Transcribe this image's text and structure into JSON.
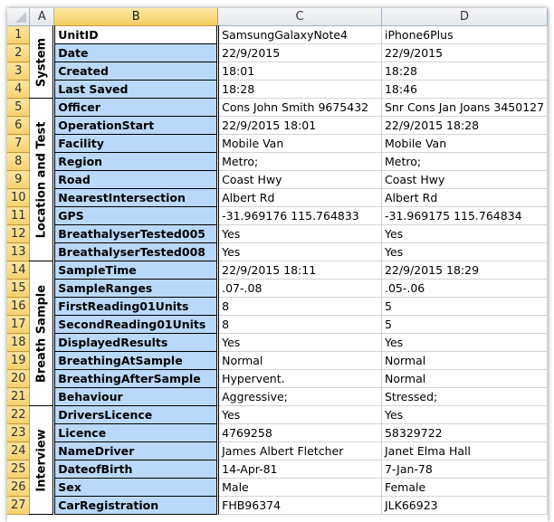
{
  "columns": [
    "A",
    "B",
    "C",
    "D"
  ],
  "groups": [
    {
      "label": "System",
      "start": 1,
      "span": 4
    },
    {
      "label": "Location and Test",
      "start": 5,
      "span": 9
    },
    {
      "label": "Breath Sample",
      "start": 14,
      "span": 8
    },
    {
      "label": "Interview",
      "start": 22,
      "span": 6
    }
  ],
  "rows": [
    {
      "n": "1",
      "field": "UnitID",
      "c": "SamsungGalaxyNote4",
      "d": "iPhone6Plus"
    },
    {
      "n": "2",
      "field": "Date",
      "c": "22/9/2015",
      "d": "22/9/2015"
    },
    {
      "n": "3",
      "field": "Created",
      "c": "18:01",
      "d": "18:28"
    },
    {
      "n": "4",
      "field": "Last Saved",
      "c": "18:28",
      "d": "18:46"
    },
    {
      "n": "5",
      "field": "Officer",
      "c": "Cons John Smith 9675432",
      "d": "Snr Cons Jan Joans 3450127"
    },
    {
      "n": "6",
      "field": "OperationStart",
      "c": "22/9/2015 18:01",
      "d": "22/9/2015 18:28"
    },
    {
      "n": "7",
      "field": "Facility",
      "c": "Mobile Van",
      "d": "Mobile Van"
    },
    {
      "n": "8",
      "field": "Region",
      "c": "Metro;",
      "d": "Metro;"
    },
    {
      "n": "9",
      "field": "Road",
      "c": "Coast Hwy",
      "d": "Coast Hwy"
    },
    {
      "n": "10",
      "field": "NearestIntersection",
      "c": "Albert Rd",
      "d": "Albert Rd"
    },
    {
      "n": "11",
      "field": "GPS",
      "c": "-31.969176  115.764833",
      "d": "-31.969175  115.764834"
    },
    {
      "n": "12",
      "field": "BreathalyserTested005",
      "c": "Yes",
      "d": "Yes"
    },
    {
      "n": "13",
      "field": "BreathalyserTested008",
      "c": "Yes",
      "d": "Yes"
    },
    {
      "n": "14",
      "field": "SampleTime",
      "c": "22/9/2015 18:11",
      "d": "22/9/2015 18:29"
    },
    {
      "n": "15",
      "field": "SampleRanges",
      "c": ".07-.08",
      "d": ".05-.06"
    },
    {
      "n": "16",
      "field": "FirstReading01Units",
      "c": "8",
      "d": "5"
    },
    {
      "n": "17",
      "field": "SecondReading01Units",
      "c": "8",
      "d": "5"
    },
    {
      "n": "18",
      "field": "DisplayedResults",
      "c": "Yes",
      "d": "Yes"
    },
    {
      "n": "19",
      "field": "BreathingAtSample",
      "c": "Normal",
      "d": "Normal"
    },
    {
      "n": "20",
      "field": "BreathingAfterSample",
      "c": "Hypervent.",
      "d": "Normal"
    },
    {
      "n": "21",
      "field": "Behaviour",
      "c": "Aggressive;",
      "d": "Stressed;"
    },
    {
      "n": "22",
      "field": "DriversLicence",
      "c": "Yes",
      "d": "Yes"
    },
    {
      "n": "23",
      "field": "Licence",
      "c": "4769258",
      "d": "58329722"
    },
    {
      "n": "24",
      "field": "NameDriver",
      "c": "James Albert Fletcher",
      "d": "Janet Elma Hall"
    },
    {
      "n": "25",
      "field": "DateofBirth",
      "c": "14-Apr-81",
      "d": "7-Jan-78"
    },
    {
      "n": "26",
      "field": "Sex",
      "c": "Male",
      "d": "Female"
    },
    {
      "n": "27",
      "field": "CarRegistration",
      "c": "FHB96374",
      "d": "JLK66923"
    }
  ]
}
